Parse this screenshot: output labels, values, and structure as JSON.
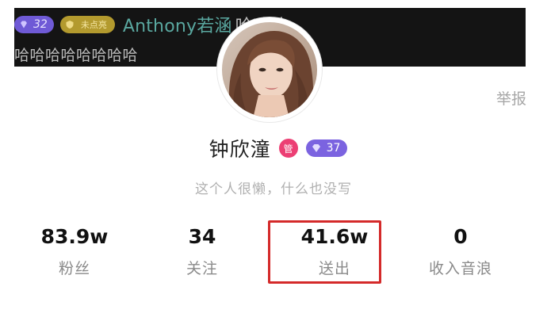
{
  "chat": {
    "level": "32",
    "fan_badge": "未点亮",
    "username": "Anthony若涵",
    "message_part1": "哈哈哈",
    "message_part2": "哈哈哈哈哈哈哈哈",
    "colors": {
      "background": "#141414",
      "username": "#5aa8a0",
      "message": "#bcbcbc",
      "level_chip": "#6f5ad6",
      "fan_chip": "#b39a2e"
    }
  },
  "header": {
    "report_label": "举报"
  },
  "profile": {
    "name": "钟欣潼",
    "admin_badge": "管",
    "level": "37",
    "bio": "这个人很懒，什么也没写",
    "avatar_icon": "user-avatar-photo",
    "colors": {
      "admin_badge": "#ec3f74",
      "level_badge": "#7b63e0"
    }
  },
  "stats": [
    {
      "value": "83.9w",
      "label": "粉丝"
    },
    {
      "value": "34",
      "label": "关注"
    },
    {
      "value": "41.6w",
      "label": "送出",
      "highlighted": true
    },
    {
      "value": "0",
      "label": "收入音浪"
    }
  ],
  "highlight": {
    "color": "#d42a2a"
  }
}
